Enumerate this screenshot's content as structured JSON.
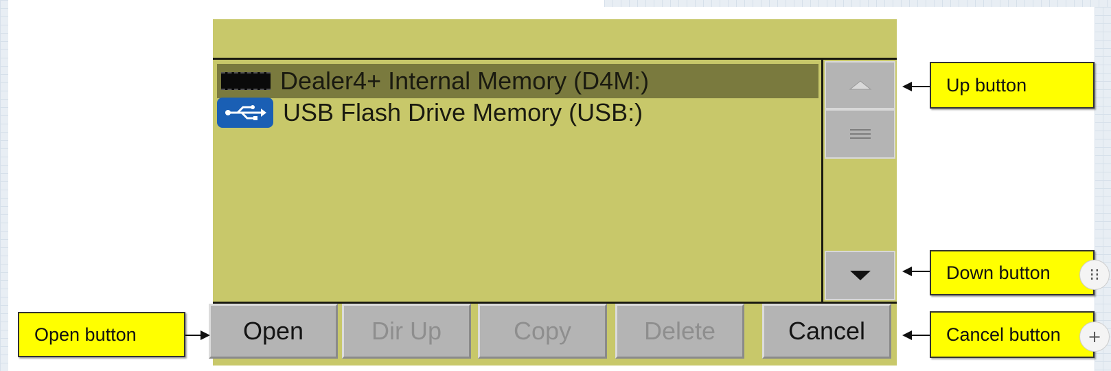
{
  "file_list": {
    "items": [
      {
        "label": "Dealer4+ Internal Memory (D4M:)",
        "icon": "memory-chip-icon",
        "selected": true
      },
      {
        "label": "USB Flash Drive Memory (USB:)",
        "icon": "usb-icon",
        "selected": false
      }
    ]
  },
  "buttons": {
    "open": "Open",
    "dir_up": "Dir Up",
    "copy": "Copy",
    "delete": "Delete",
    "cancel": "Cancel"
  },
  "callouts": {
    "up": "Up button",
    "down": "Down button",
    "open": "Open button",
    "cancel": "Cancel button"
  },
  "extras": {
    "plus": "+",
    "drag": "⁝⁝"
  },
  "colors": {
    "screen_bg": "#c8c86a",
    "selected_row": "#7a7a3e",
    "button_bg": "#b4b4b4",
    "callout_bg": "#ffff00",
    "usb_blue": "#1a5fb4"
  }
}
